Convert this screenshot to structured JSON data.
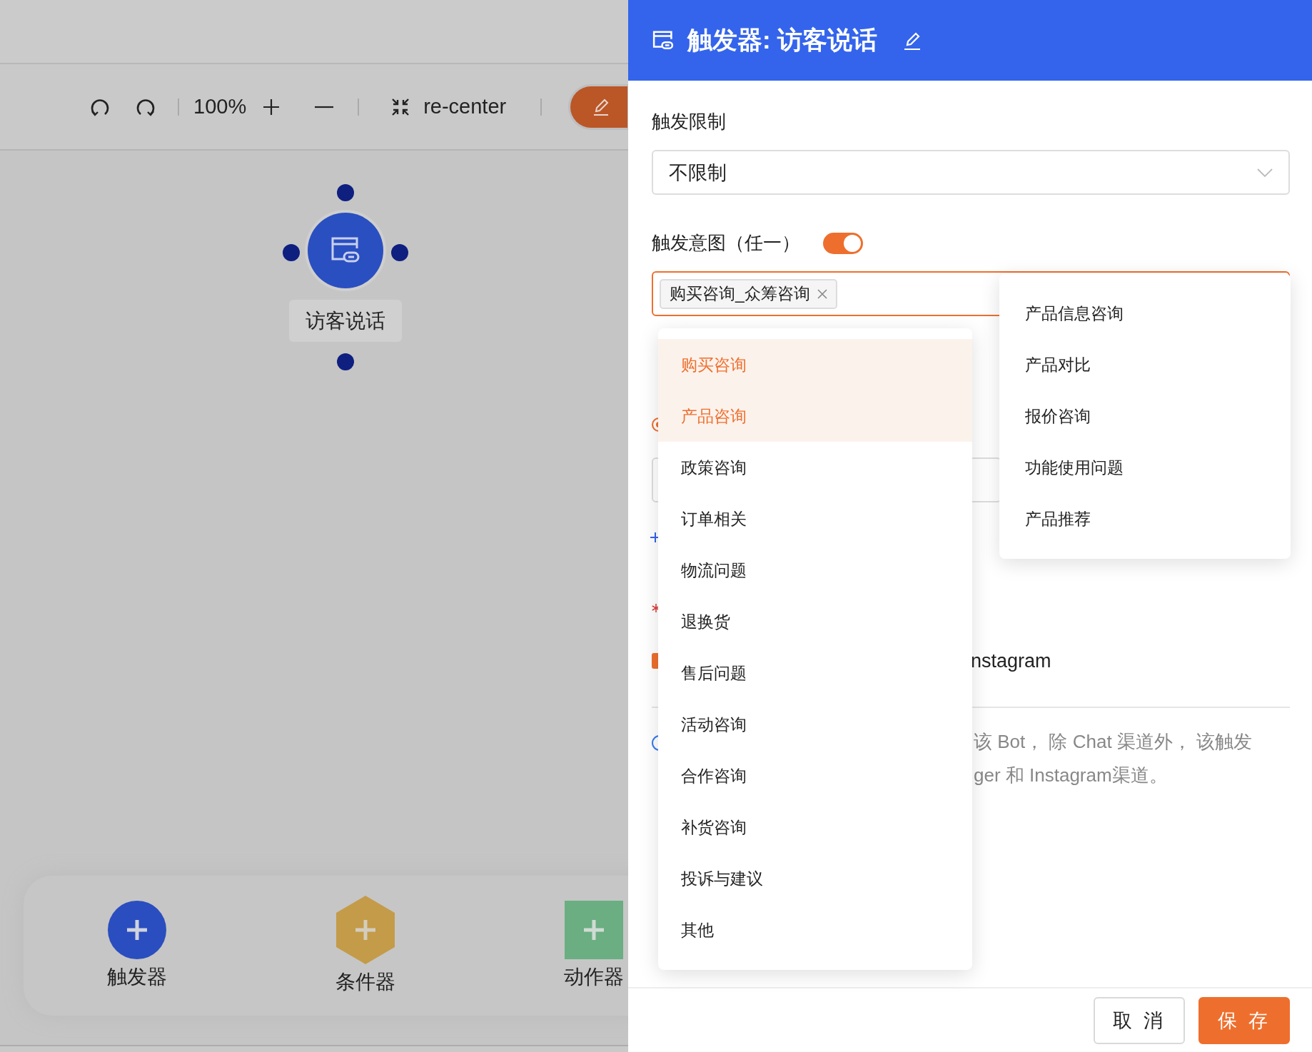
{
  "canvas": {
    "toolbar": {
      "zoom": "100%",
      "recenter": "re-center"
    },
    "node": {
      "label": "访客说话"
    },
    "palette": [
      {
        "kind": "circle",
        "label": "触发器"
      },
      {
        "kind": "hexagon",
        "label": "条件器"
      },
      {
        "kind": "square",
        "label": "动作器"
      }
    ]
  },
  "drawer": {
    "title": "触发器: 访客说话",
    "limit": {
      "label": "触发限制",
      "value": "不限制"
    },
    "intent": {
      "label": "触发意图（任一）",
      "on": true,
      "tags": [
        {
          "label": "购买咨询_众筹咨询"
        }
      ]
    },
    "behind": {
      "radio": {
        "selected": true
      },
      "checkbox": {
        "checked": true
      },
      "channel_text": "nstagram",
      "note_lines": [
        "该 Bot， 除 Chat 渠道外， 该触发",
        "ger 和 Instagram渠道。"
      ]
    },
    "menu": [
      {
        "label": "购买咨询",
        "selected": true
      },
      {
        "label": "产品咨询",
        "selected": true
      },
      {
        "label": "政策咨询",
        "selected": false
      },
      {
        "label": "订单相关",
        "selected": false
      },
      {
        "label": "物流问题",
        "selected": false
      },
      {
        "label": "退换货",
        "selected": false
      },
      {
        "label": "售后问题",
        "selected": false
      },
      {
        "label": "活动咨询",
        "selected": false
      },
      {
        "label": "合作咨询",
        "selected": false
      },
      {
        "label": "补货咨询",
        "selected": false
      },
      {
        "label": "投诉与建议",
        "selected": false
      },
      {
        "label": "其他",
        "selected": false
      }
    ],
    "submenu": [
      {
        "label": "产品信息咨询",
        "selected": false
      },
      {
        "label": "产品对比",
        "selected": false
      },
      {
        "label": "报价咨询",
        "selected": false
      },
      {
        "label": "功能使用问题",
        "selected": false
      },
      {
        "label": "产品推荐",
        "selected": false
      }
    ],
    "buttons": [
      {
        "kind": "default",
        "label": "取 消"
      },
      {
        "kind": "primary",
        "label": "保 存"
      }
    ]
  }
}
